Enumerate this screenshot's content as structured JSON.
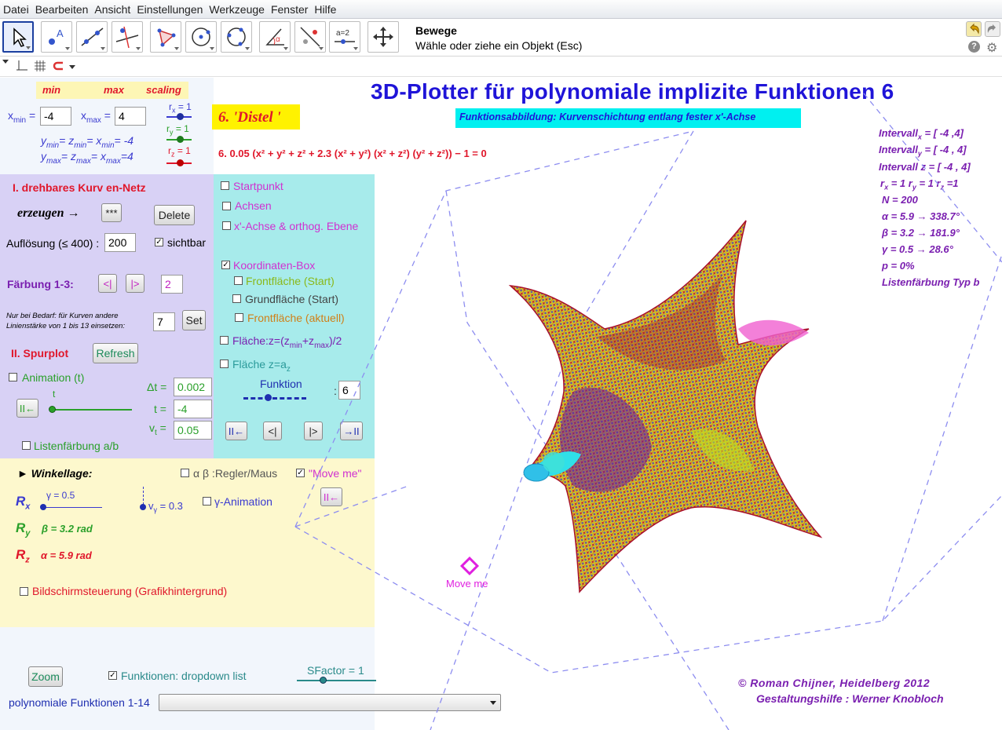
{
  "menu": [
    "Datei",
    "Bearbeiten",
    "Ansicht",
    "Einstellungen",
    "Werkzeuge",
    "Fenster",
    "Hilfe"
  ],
  "toolbar": {
    "tool_title": "Bewege",
    "tool_help": "Wähle oder ziehe ein Objekt (Esc)",
    "slider_tool_label": "a=2"
  },
  "header": {
    "title": "3D-Plotter für polynomiale  implizite Funktionen 6",
    "subtitle": "Funktionsabbildung: Kurvenschichtung  entlang fester x'-Achse",
    "function_name": "6. 'Distel '",
    "equation": "6.  0.05  (x² + y² + z² + 2.3  (x² + y²)  (x² + z²)  (y² + z²))  − 1 = 0"
  },
  "range": {
    "min_label": "min",
    "max_label": "max",
    "scaling_label": "scaling",
    "xmin_label": "x",
    "xmin_sub": "min",
    "xmin_value": "-4",
    "xmax_label": "x",
    "xmax_sub": "max",
    "xmax_value": "4",
    "rx": "r",
    "rx_sub": "x",
    "rx_val": "= 1",
    "ry": "r",
    "ry_sub": "y",
    "ry_val": "= 1",
    "rz": "r",
    "rz_sub": "z",
    "rz_val": "= 1",
    "ymin_line": "y",
    "ymin_line2": "= z",
    "ymin_line3": "= x",
    "ymin_line4": "= -4",
    "ymin_sub": "min",
    "ymax_line": "y",
    "ymax_line2": "= z",
    "ymax_line3": "= x",
    "ymax_line4": "=4",
    "ymax_sub": "max"
  },
  "net": {
    "heading": "I. drehbares Kurv en-Netz",
    "create_label": "erzeugen →",
    "star_button": "***",
    "delete_button": "Delete",
    "resolution_label": "Auflösung (≤ 400) :",
    "resolution_value": "200",
    "visible_label": "sichtbar",
    "coloring_label": "Färbung 1-3:",
    "prev_button": "<|",
    "next_button": "|>",
    "coloring_value": "2",
    "hint_line1": "Nur bei Bedarf:  für Kurven andere",
    "hint_line2": "Linienstärke von 1 bis 13 einsetzen:",
    "linewidth_value": "7",
    "set_button": "Set"
  },
  "trace": {
    "heading": "II.  Spurplot",
    "refresh_button": "Refresh",
    "animation_label": "Animation (t)",
    "dt_label": "Δt =",
    "dt_value": "0.002",
    "t_label": "t =",
    "t_value": "-4",
    "t_slider_label": "t",
    "vt_label": "v",
    "vt_sub": "t",
    "vt_eq": "=",
    "vt_value": "0.05",
    "reset_button": "II←",
    "list_coloring_label": "Listenfärbung  a/b"
  },
  "checks": {
    "startpoint": "Startpunkt",
    "axes": "Achsen",
    "xaxis_plane": "x'-Achse & orthog. Ebene",
    "coord_box": "Koordinaten-Box",
    "front_start": "Frontfläche (Start)",
    "ground_start": "Grundfläche (Start)",
    "front_current": "Frontfläche (aktuell)",
    "surface_mid": "Fläche:z=(z",
    "surface_mid_sub1": "min",
    "surface_mid_plus": "+z",
    "surface_mid_sub2": "max",
    "surface_mid_end": ")/2",
    "surface_az": "Fläche z=a",
    "surface_az_sub": "z",
    "function_label": "Funktion",
    "function_value": "6",
    "btn_first": "II←",
    "btn_prev": "<|",
    "btn_next": "|>",
    "btn_last": "→II"
  },
  "angles": {
    "heading": "Winkellage:",
    "regler_label": "α β :Regler/Maus",
    "moveme_label": "\"Move me\"",
    "rx": "R",
    "rx_sub": "x",
    "gamma_label": "γ = 0.5",
    "vgamma_label": "v",
    "vgamma_sub": "γ",
    "vgamma_val": "= 0.3",
    "gamma_anim_label": "γ-Animation",
    "ry": "R",
    "ry_sub": "y",
    "beta_label": "β = 3.2 rad",
    "rz": "R",
    "rz_sub": "z",
    "alpha_label": "α = 5.9 rad",
    "screen_control": "Bildschirmsteuerung (Grafikhintergrund)",
    "reset_button": "II←"
  },
  "bottom": {
    "zoom_button": "Zoom",
    "dropdown_label": "Funktionen: dropdown list",
    "sfactor_label": "SFactor = 1",
    "poly_label": "polynomiale Funktionen 1-14",
    "select_value": ""
  },
  "info": {
    "interval_x": "Intervall",
    "interval_x_sub": "x",
    "interval_x_val": "= [ -4 ,4]",
    "interval_y": "Intervall",
    "interval_y_sub": "y",
    "interval_y_val": "= [ -4  ,  4]",
    "interval_z": "Intervall z = [  -4 ,  4]",
    "r_line": " r",
    "r_x_sub": "x",
    "r_x_val": "= 1  r",
    "r_y_sub": "y",
    "r_y_val": "= 1  r",
    "r_z_sub": "z",
    "r_z_val": "=1",
    "n_line": "N = 200",
    "alpha_line": "α = 5.9 → 338.7°",
    "beta_line": "β = 3.2 → 181.9°",
    "gamma_line": "γ = 0.5 → 28.6°",
    "p_line": "p = 0%",
    "coloring_line": "Listenfärbung Typ b"
  },
  "graphics": {
    "move_me": "Move me"
  },
  "credits": {
    "line1": "©  Roman Chijner,  Heidelberg 2012",
    "line2": "Gestaltungshilfe : Werner Knobloch"
  },
  "colors": {
    "title_blue": "#1f14d8",
    "heading_red": "#e0172b",
    "purple_text": "#7a1fb0",
    "magenta": "#e020e0"
  }
}
